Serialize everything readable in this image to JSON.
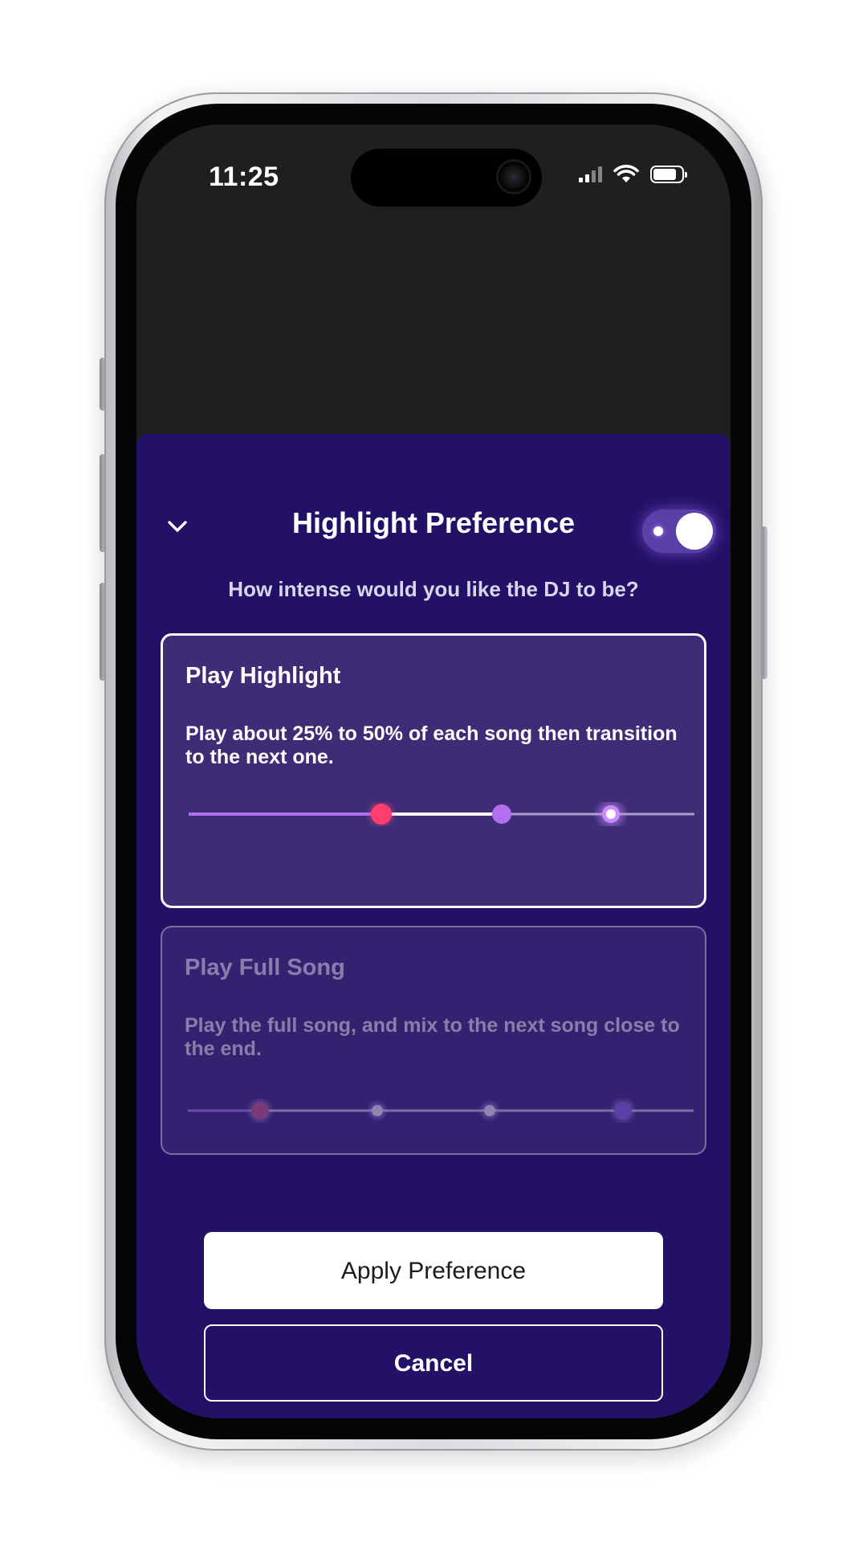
{
  "status_bar": {
    "time": "11:25",
    "icons": [
      "signal-icon",
      "wifi-icon",
      "battery-icon"
    ]
  },
  "sheet": {
    "title": "Highlight Preference",
    "subtitle": "How intense would you like the DJ to be?",
    "toggle": {
      "on": true
    },
    "collapse_icon": "chevron-down-icon"
  },
  "options": [
    {
      "title": "Play Highlight",
      "description": "Play about 25% to 50% of each song then transition to the next one.",
      "selected": true
    },
    {
      "title": "Play Full Song",
      "description": "Play the full song, and mix to the next song close to the end.",
      "selected": false
    }
  ],
  "actions": {
    "apply_label": "Apply Preference",
    "cancel_label": "Cancel"
  },
  "colors": {
    "sheet_background": "#221166",
    "selected_card": "#3e2c77",
    "accent_purple": "#b46ef0",
    "accent_pink": "#ff3d6e"
  }
}
